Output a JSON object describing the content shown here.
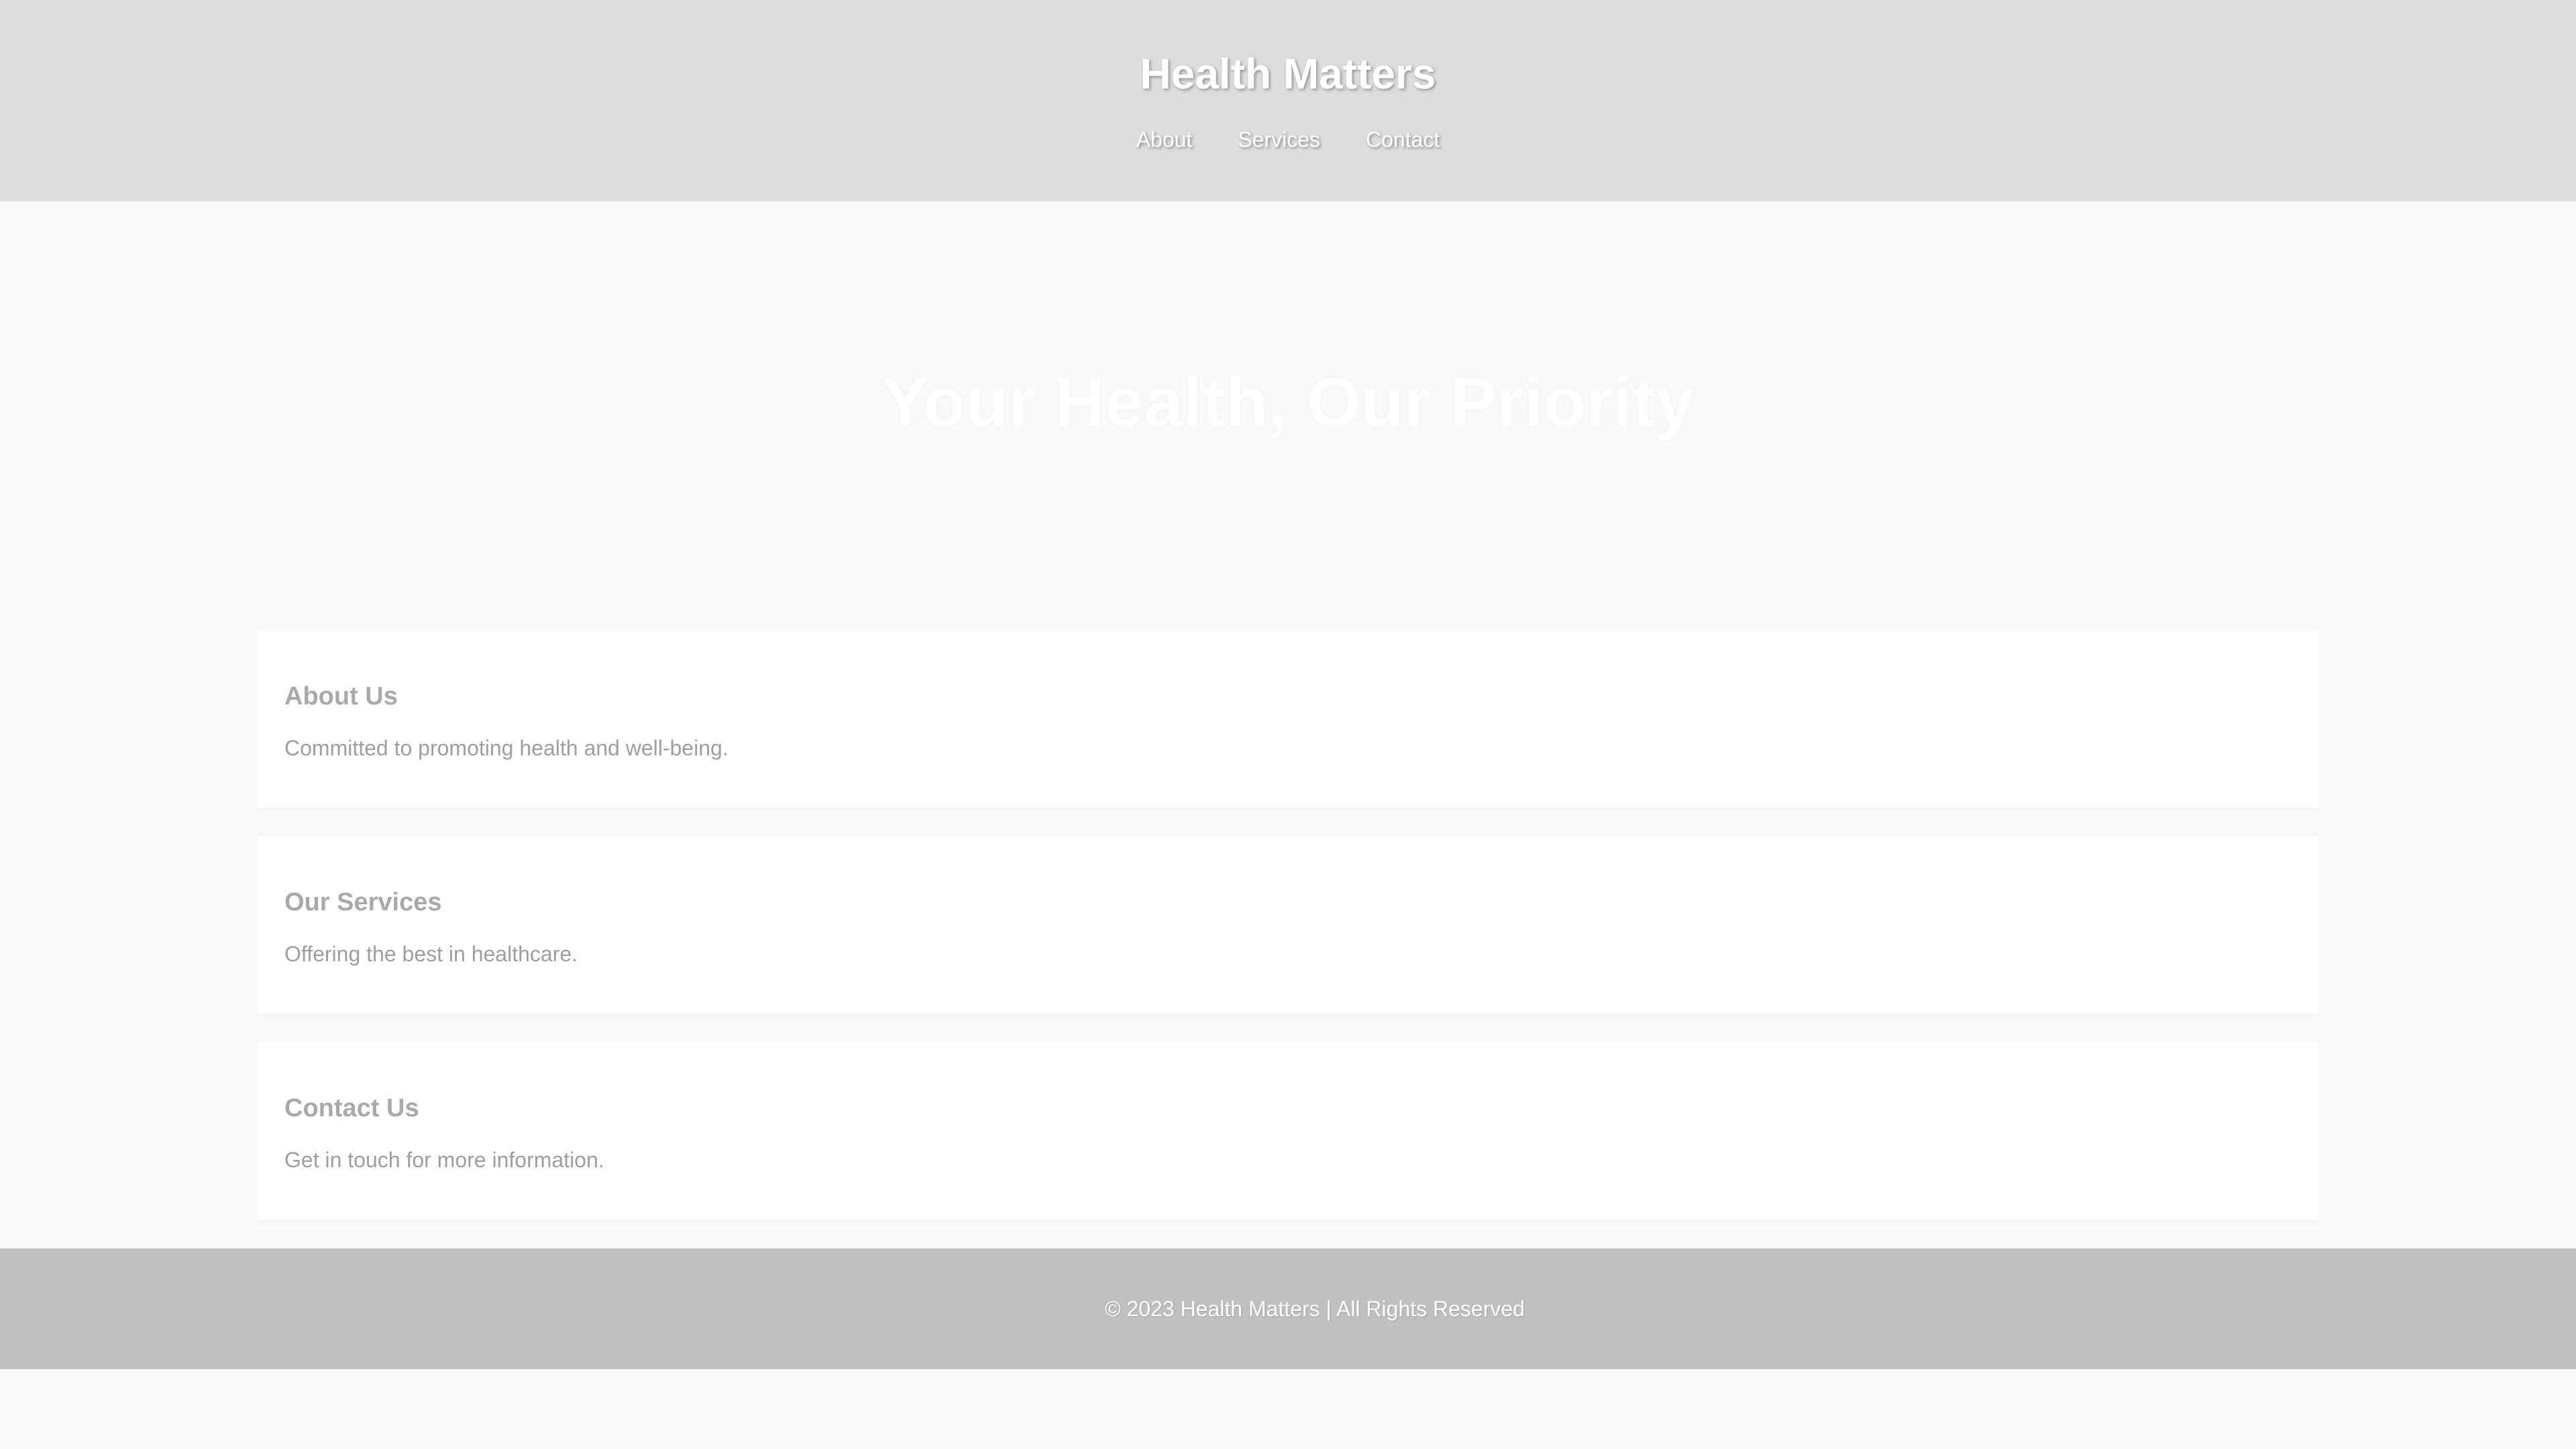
{
  "header": {
    "title": "Health Matters",
    "nav": [
      {
        "label": "About"
      },
      {
        "label": "Services"
      },
      {
        "label": "Contact"
      }
    ]
  },
  "hero": {
    "title": "Your Health, Our Priority"
  },
  "sections": [
    {
      "title": "About Us",
      "text": "Committed to promoting health and well-being."
    },
    {
      "title": "Our Services",
      "text": "Offering the best in healthcare."
    },
    {
      "title": "Contact Us",
      "text": "Get in touch for more information."
    }
  ],
  "footer": {
    "text": "© 2023 Health Matters | All Rights Reserved"
  },
  "colors": {
    "header_bg": "#dddddd",
    "page_bg": "#fafafa",
    "card_bg": "#ffffff",
    "footer_bg": "#c0c0c0",
    "heading_text": "#a9a9a9",
    "body_text": "#9e9e9e"
  }
}
